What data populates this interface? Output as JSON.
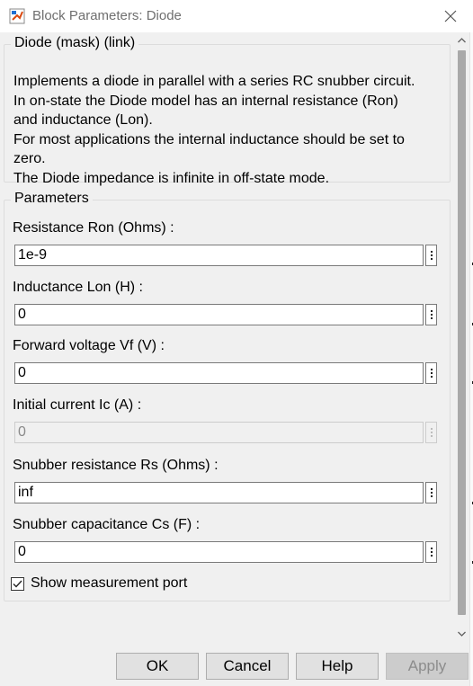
{
  "window": {
    "title": "Block Parameters: Diode",
    "icon": "simulink-block-icon",
    "close_icon": "close-icon"
  },
  "description_group": {
    "legend": "Diode (mask) (link)",
    "lines": [
      "Implements a diode in parallel with a series RC snubber circuit.",
      "In on-state the Diode model has an internal resistance (Ron)",
      "and inductance (Lon).",
      "For most applications the internal inductance should be set to",
      "zero.",
      "The Diode impedance is infinite in off-state mode."
    ]
  },
  "parameters_group": {
    "legend": "Parameters",
    "fields": [
      {
        "label": "Resistance Ron (Ohms) :",
        "value": "1e-9",
        "enabled": true
      },
      {
        "label": "Inductance Lon (H) :",
        "value": "0",
        "enabled": true
      },
      {
        "label": "Forward voltage Vf (V) :",
        "value": "0",
        "enabled": true
      },
      {
        "label": "Initial current Ic (A) :",
        "value": "0",
        "enabled": false
      },
      {
        "label": "Snubber resistance Rs (Ohms) :",
        "value": "inf",
        "enabled": true
      },
      {
        "label": "Snubber capacitance Cs (F) :",
        "value": "0",
        "enabled": true
      }
    ],
    "show_measurement_port": {
      "label": "Show measurement port",
      "checked": true
    }
  },
  "buttons": {
    "ok": "OK",
    "cancel": "Cancel",
    "help": "Help",
    "apply": "Apply"
  },
  "colors": {
    "background": "#f0f0f0",
    "input_border": "#7a7a7a",
    "disabled_text": "#8a8a8a",
    "title_text": "#6f6f6f"
  }
}
